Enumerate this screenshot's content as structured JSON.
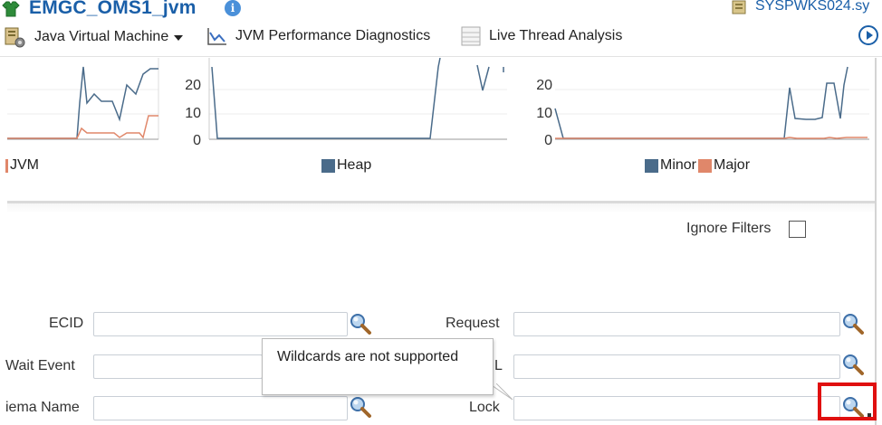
{
  "header": {
    "title": "EMGC_OMS1_jvm",
    "host_link": "SYSPWKS024.sy"
  },
  "toolbar": {
    "menu_label": "Java Virtual Machine",
    "perf_label": "JVM Performance Diagnostics",
    "thread_label": "Live Thread Analysis"
  },
  "charts": {
    "legend_jvm": "JVM",
    "legend_heap": "Heap",
    "legend_minor": "Minor",
    "legend_major": "Major",
    "colors": {
      "primary": "#4a6b8a",
      "secondary": "#e0876a"
    },
    "heap_axis_ticks": [
      "20",
      "10",
      "0"
    ],
    "gc_axis_ticks": [
      "20",
      "10",
      "0"
    ]
  },
  "filters": {
    "ignore_label": "Ignore Filters",
    "ignore_checked": false
  },
  "form": {
    "ecid_label": "ECID",
    "wait_event_label": "Wait Event",
    "schema_label": "iema Name",
    "request_label": "Request",
    "sql_label": "L",
    "lock_label": "Lock",
    "ecid_value": "",
    "wait_value": "",
    "schema_value": "",
    "request_value": "",
    "sql_value": "",
    "lock_value": ""
  },
  "tooltip": {
    "text": "Wildcards are not supported"
  },
  "colors": {
    "accent": "#1a5fa8",
    "highlight": "#e01010"
  }
}
